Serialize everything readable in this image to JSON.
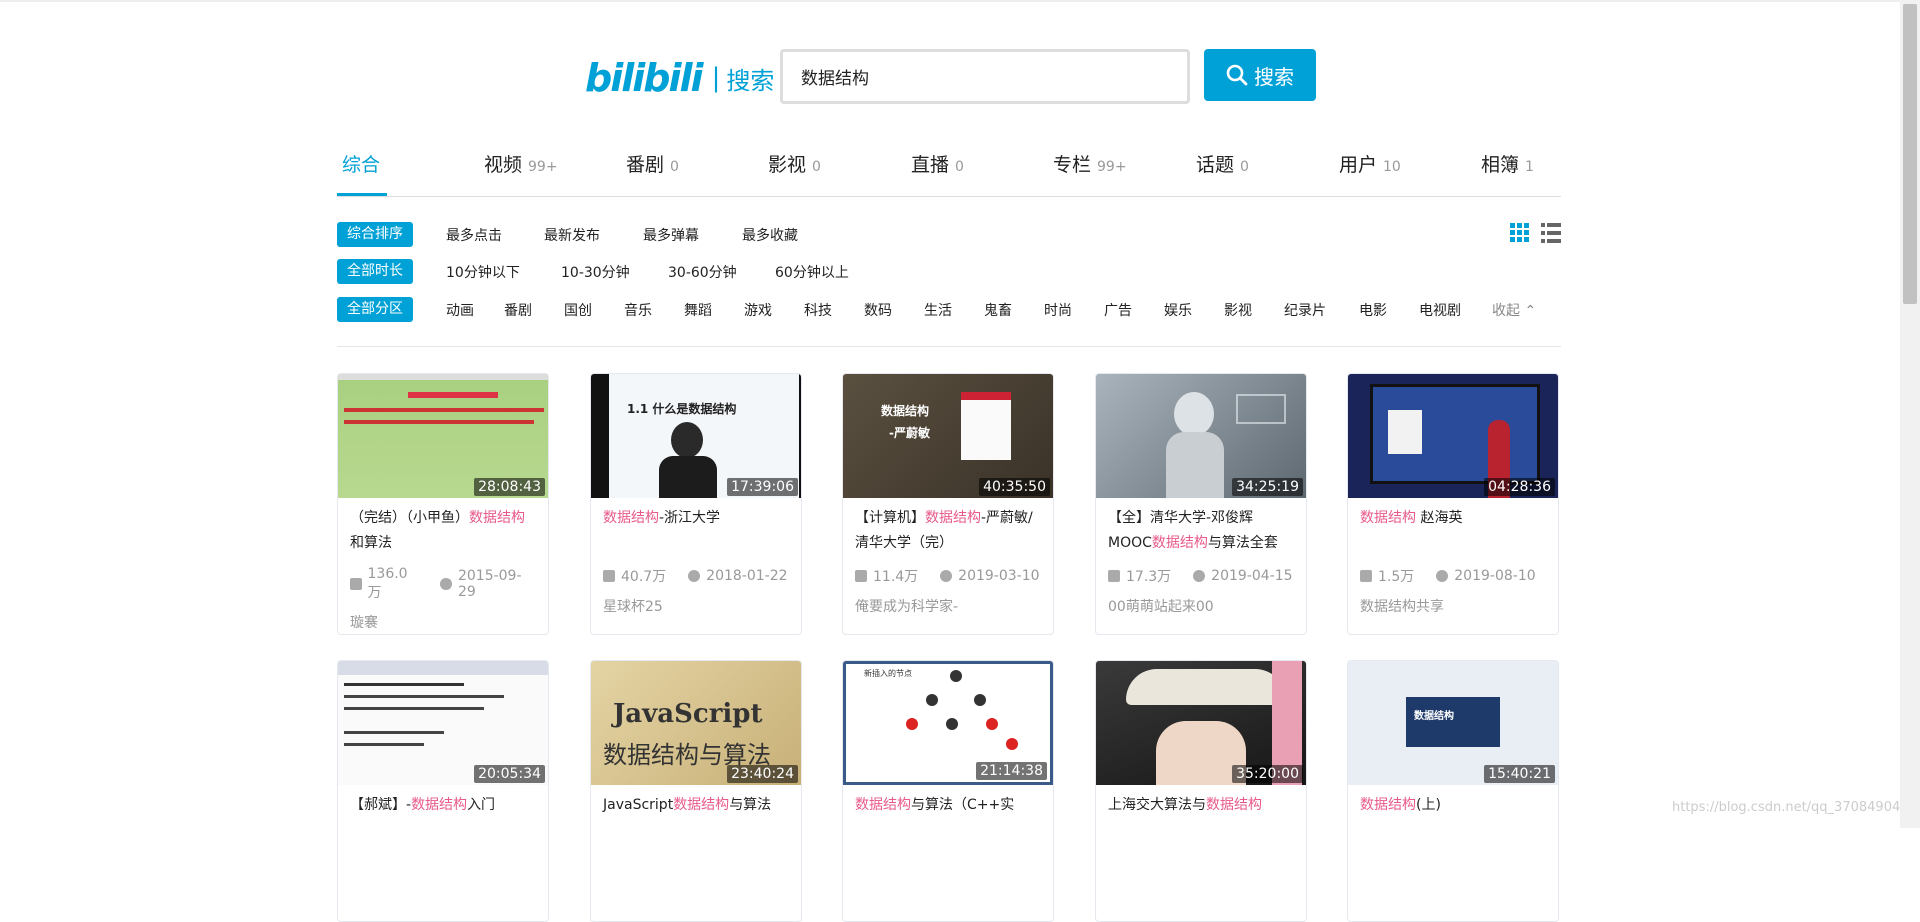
{
  "logo": {
    "brand": "bilibili",
    "separator": "|",
    "word": "搜索"
  },
  "search": {
    "value": "数据结构",
    "button": "搜索"
  },
  "tabs": [
    {
      "label": "综合",
      "count": ""
    },
    {
      "label": "视频",
      "count": "99+"
    },
    {
      "label": "番剧",
      "count": "0"
    },
    {
      "label": "影视",
      "count": "0"
    },
    {
      "label": "直播",
      "count": "0"
    },
    {
      "label": "专栏",
      "count": "99+"
    },
    {
      "label": "话题",
      "count": "0"
    },
    {
      "label": "用户",
      "count": "10"
    },
    {
      "label": "相簿",
      "count": "1"
    }
  ],
  "filters": {
    "order": {
      "active": "综合排序",
      "options": [
        "最多点击",
        "最新发布",
        "最多弹幕",
        "最多收藏"
      ]
    },
    "duration": {
      "active": "全部时长",
      "options": [
        "10分钟以下",
        "10-30分钟",
        "30-60分钟",
        "60分钟以上"
      ]
    },
    "zone": {
      "active": "全部分区",
      "options": [
        "动画",
        "番剧",
        "国创",
        "音乐",
        "舞蹈",
        "游戏",
        "科技",
        "数码",
        "生活",
        "鬼畜",
        "时尚",
        "广告",
        "娱乐",
        "影视",
        "纪录片",
        "电影",
        "电视剧"
      ],
      "collapse": "收起"
    }
  },
  "videos": [
    {
      "duration": "28:08:43",
      "title_pre": "（完结）（小甲鱼）",
      "title_hl": "数据结构",
      "title_post": "和算法",
      "views": "136.0万",
      "date": "2015-09-29",
      "uploader": "璇褰"
    },
    {
      "duration": "17:39:06",
      "title_pre": "",
      "title_hl": "数据结构",
      "title_post": "-浙江大学",
      "views": "40.7万",
      "date": "2018-01-22",
      "uploader": "星球杯25"
    },
    {
      "duration": "40:35:50",
      "title_pre": "【计算机】",
      "title_hl": "数据结构",
      "title_post": "-严蔚敏/清华大学（完）",
      "views": "11.4万",
      "date": "2019-03-10",
      "uploader": "俺要成为科学家-"
    },
    {
      "duration": "34:25:19",
      "title_pre": "【全】清华大学-邓俊辉MOOC",
      "title_hl": "数据结构",
      "title_post": "与算法全套",
      "views": "17.3万",
      "date": "2019-04-15",
      "uploader": "00萌萌站起来00"
    },
    {
      "duration": "04:28:36",
      "title_pre": "",
      "title_hl": "数据结构",
      "title_post": " 赵海英",
      "views": "1.5万",
      "date": "2019-08-10",
      "uploader": "数据结构共享"
    },
    {
      "duration": "20:05:34",
      "title_pre": "【郝斌】-",
      "title_hl": "数据结构",
      "title_post": "入门",
      "views": "",
      "date": "",
      "uploader": ""
    },
    {
      "duration": "23:40:24",
      "title_pre": "JavaScript",
      "title_hl": "数据结构",
      "title_post": "与算法",
      "views": "",
      "date": "",
      "uploader": ""
    },
    {
      "duration": "21:14:38",
      "title_pre": "",
      "title_hl": "数据结构",
      "title_post": "与算法（C++实",
      "views": "",
      "date": "",
      "uploader": ""
    },
    {
      "duration": "35:20:00",
      "title_pre": "上海交大算法与",
      "title_hl": "数据结构",
      "title_post": "",
      "views": "",
      "date": "",
      "uploader": ""
    },
    {
      "duration": "15:40:21",
      "title_pre": "",
      "title_hl": "数据结构",
      "title_post": "(上)",
      "views": "",
      "date": "",
      "uploader": ""
    }
  ],
  "thumb_text": {
    "v2": "1.1 什么是数据结构",
    "v3a": "数据结构",
    "v3b": "-严蔚敏",
    "v7a": "JavaScript",
    "v7b": "数据结构与算法",
    "v8": "新插入的节点",
    "v10": "数据结构"
  },
  "watermark": "https://blog.csdn.net/qq_37084904"
}
